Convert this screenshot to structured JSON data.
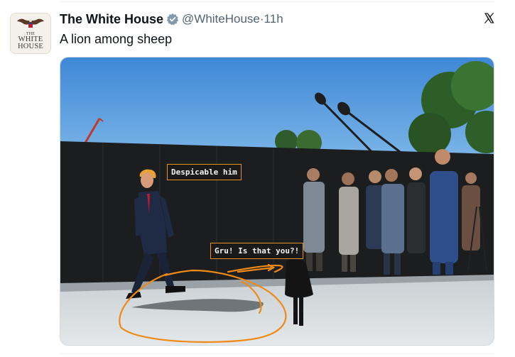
{
  "post": {
    "display_name": "The White House",
    "handle": "@WhiteHouse",
    "separator": "·",
    "time": "11h",
    "text": "A lion among sheep",
    "avatar_label": "THE WHITE HOUSE",
    "verified_color": "#829aab"
  },
  "image": {
    "caption_left": "Despicable him",
    "caption_right": "Gru! Is that you?!",
    "annotation_color": "#f08a16"
  },
  "icons": {
    "verified": "verified-badge-icon",
    "more": "x-logo-icon"
  }
}
